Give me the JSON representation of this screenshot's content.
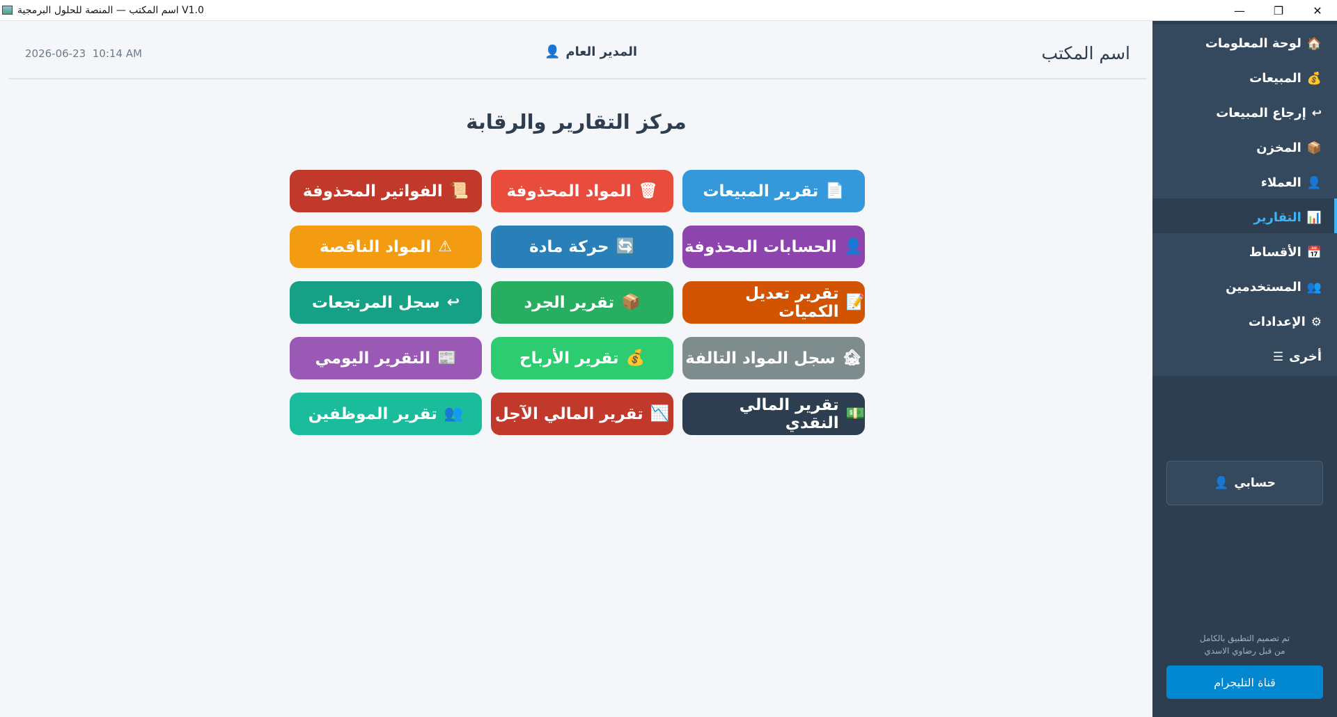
{
  "window": {
    "title": "V1.0 اسم المكتب — المنصة للحلول البرمجية",
    "minimize_icon": "—",
    "restore_icon": "❐",
    "close_icon": "✕"
  },
  "header": {
    "office_name": "اسم المكتب",
    "manager_label": "المدير العام",
    "manager_icon": "👤",
    "date": "2026-06-23",
    "time": "10:14 AM"
  },
  "page": {
    "title": "مركز التقارير والرقابة"
  },
  "reports": [
    {
      "label": "تقرير المبيعات",
      "icon": "📄",
      "color": "#3498db"
    },
    {
      "label": "المواد المحذوفة",
      "icon": "🗑",
      "color": "#e74c3c"
    },
    {
      "label": "الفواتير المحذوفة",
      "icon": "📜",
      "color": "#c0392b"
    },
    {
      "label": "الحسابات المحذوفة",
      "icon": "👤",
      "color": "#8e44ad"
    },
    {
      "label": "حركة مادة",
      "icon": "🔄",
      "color": "#2980b9"
    },
    {
      "label": "المواد الناقصة",
      "icon": "⚠",
      "color": "#f39c12"
    },
    {
      "label": "تقرير تعديل الكميات",
      "icon": "📝",
      "color": "#d35400"
    },
    {
      "label": "تقرير الجرد",
      "icon": "📦",
      "color": "#27ae60"
    },
    {
      "label": "سجل المرتجعات",
      "icon": "↩",
      "color": "#16a085"
    },
    {
      "label": "سجل المواد التالفة",
      "icon": "🏚",
      "color": "#7f8c8d"
    },
    {
      "label": "تقرير الأرباح",
      "icon": "💰",
      "color": "#2ecc71"
    },
    {
      "label": "التقرير اليومي",
      "icon": "📰",
      "color": "#9b59b6"
    },
    {
      "label": "تقرير المالي النقدي",
      "icon": "💵",
      "color": "#2c3e50"
    },
    {
      "label": "تقرير المالي الآجل",
      "icon": "📉",
      "color": "#c0392b"
    },
    {
      "label": "تقرير الموظفين",
      "icon": "👥",
      "color": "#1abc9c"
    }
  ],
  "sidebar": {
    "items": [
      {
        "label": "لوحة المعلومات",
        "icon": "🏠"
      },
      {
        "label": "المبيعات",
        "icon": "💰"
      },
      {
        "label": "إرجاع المبيعات",
        "icon": "↩"
      },
      {
        "label": "المخزن",
        "icon": "📦"
      },
      {
        "label": "العملاء",
        "icon": "👤"
      },
      {
        "label": "التقارير",
        "icon": "📊"
      },
      {
        "label": "الأقساط",
        "icon": "📅"
      },
      {
        "label": "المستخدمين",
        "icon": "👥"
      },
      {
        "label": "الإعدادات",
        "icon": "⚙"
      },
      {
        "label": "أخرى",
        "icon": "☰"
      }
    ],
    "active_index": 5,
    "account_label": "حسابي",
    "account_icon": "👤",
    "credit_line1": "تم تصميم التطبيق بالكامل",
    "credit_line2": "من قبل رضاوي الاسدي",
    "telegram_label": "قناة التليجرام"
  }
}
